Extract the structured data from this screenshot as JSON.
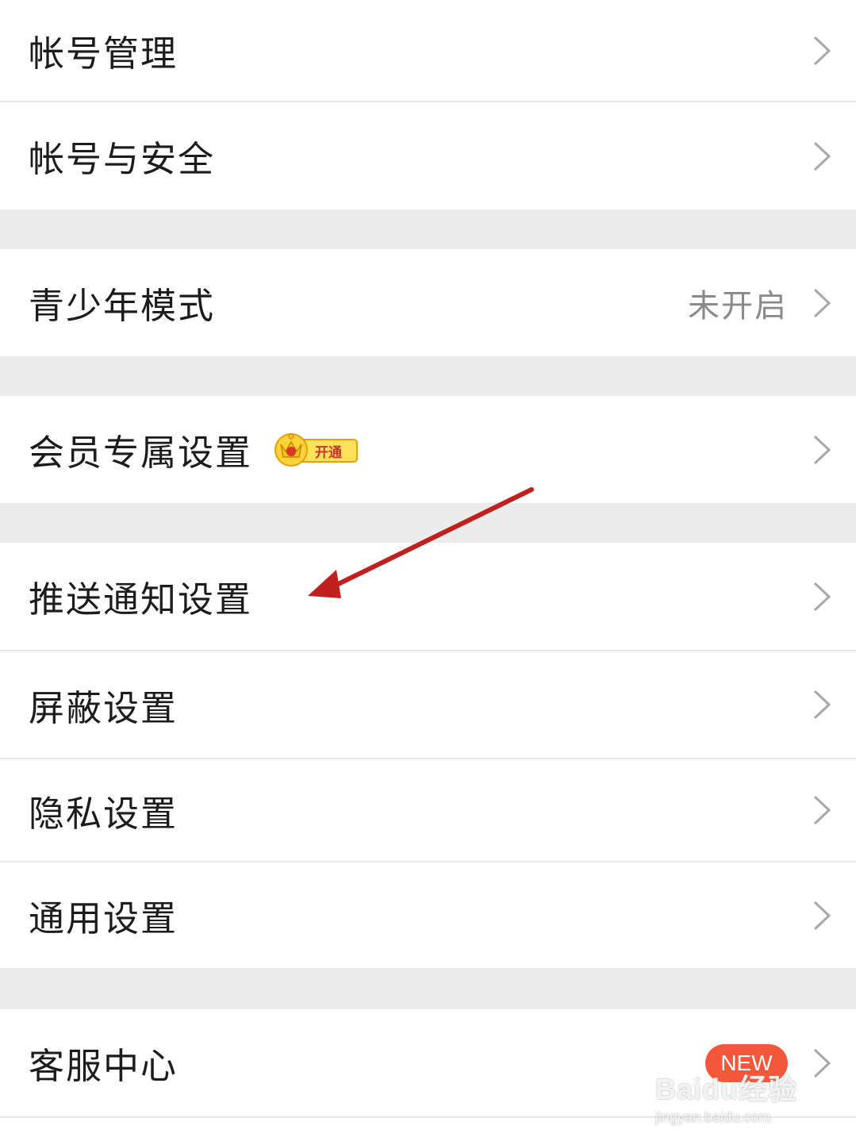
{
  "settings": {
    "account_manage": "帐号管理",
    "account_security": "帐号与安全",
    "teen_mode": "青少年模式",
    "teen_mode_status": "未开启",
    "vip_settings": "会员专属设置",
    "vip_open_label": "开通",
    "push_notifications": "推送通知设置",
    "block_settings": "屏蔽设置",
    "privacy_settings": "隐私设置",
    "general_settings": "通用设置",
    "customer_service": "客服中心",
    "new_badge": "NEW"
  },
  "watermark": {
    "brand": "Baidu经验",
    "url": "jingyan.baidu.com"
  },
  "icons": {
    "chevron": "chevron-right-icon",
    "vip": "crown-icon",
    "annotation": "red-arrow"
  },
  "colors": {
    "annotation_arrow": "#c0211f",
    "new_badge": "#f5573a",
    "separator_bg": "#ececec"
  }
}
